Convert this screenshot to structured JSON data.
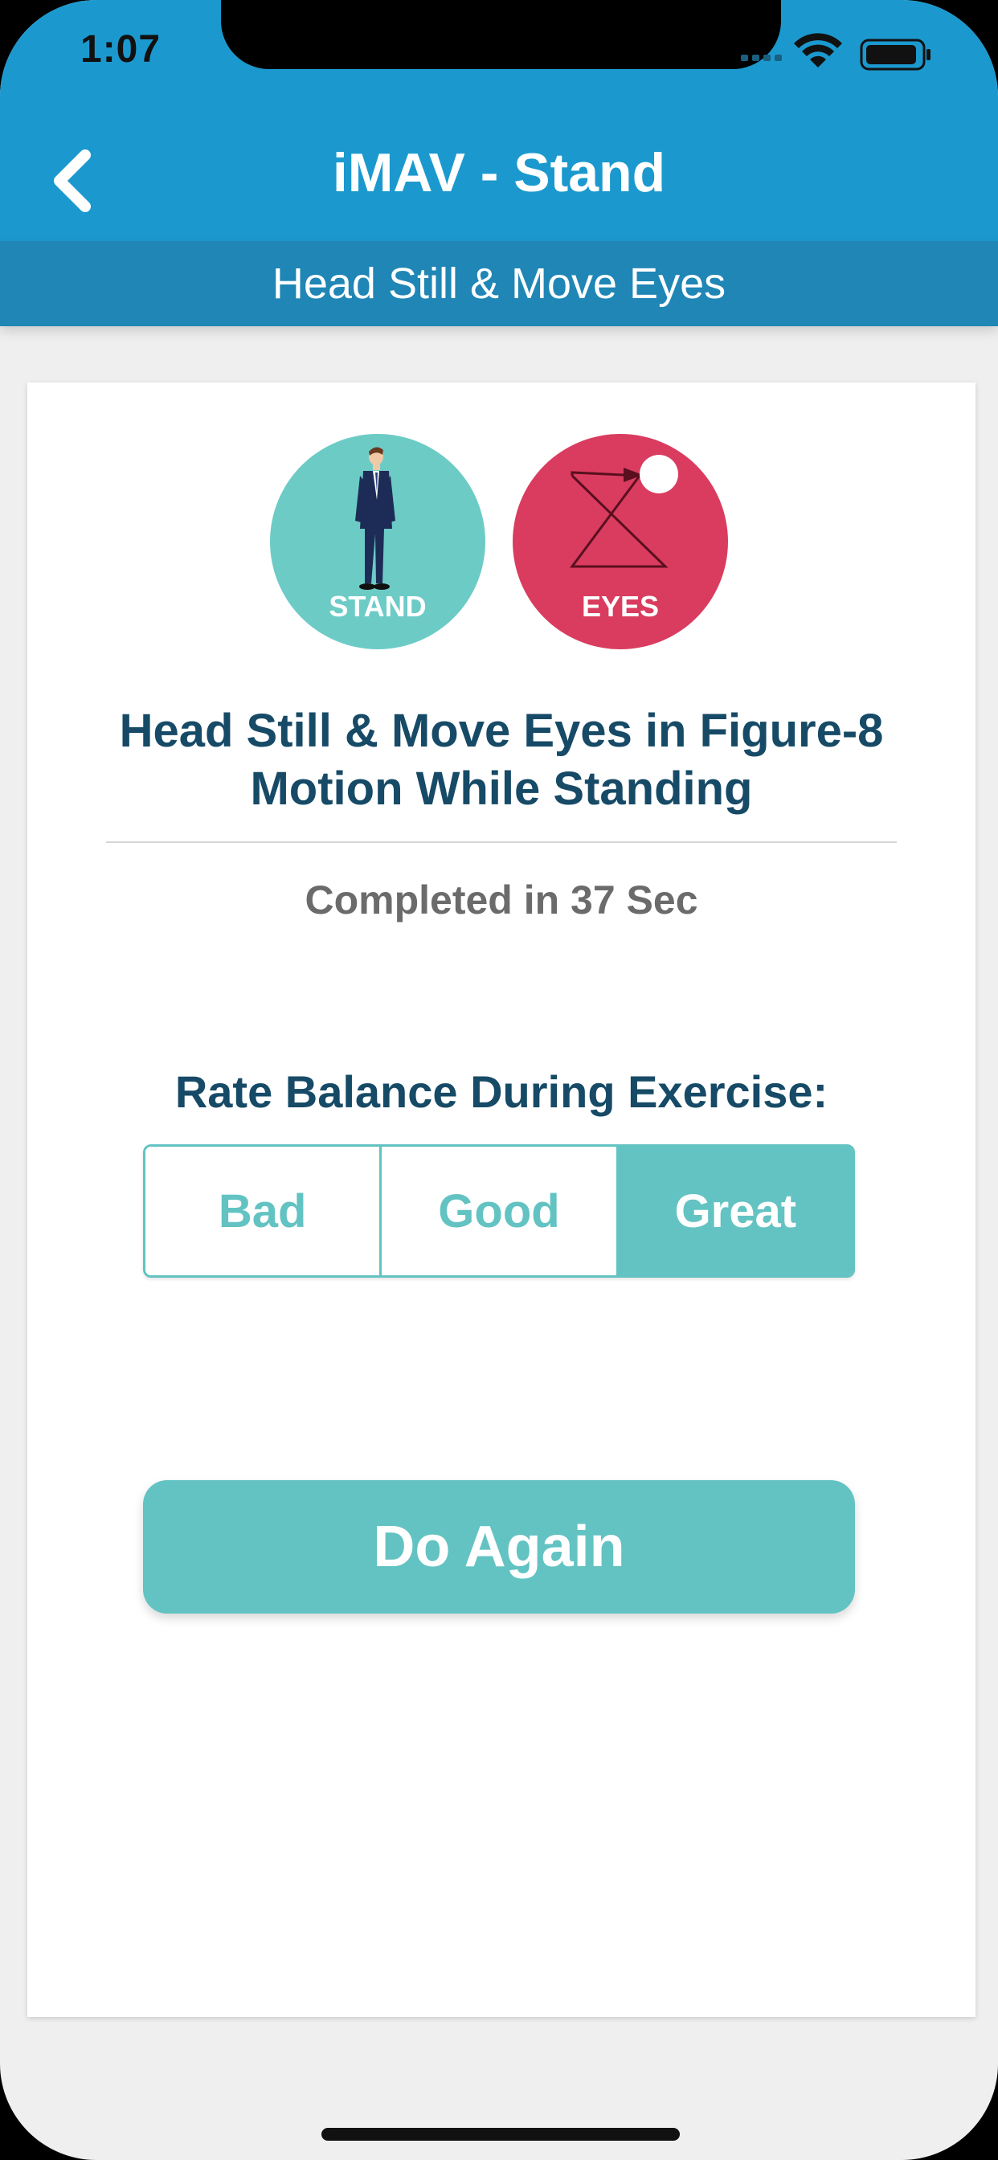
{
  "status_bar": {
    "time": "1:07"
  },
  "nav": {
    "title": "iMAV - Stand",
    "back_icon": "chevron-left-icon"
  },
  "subheader": {
    "title": "Head Still & Move Eyes"
  },
  "badges": [
    {
      "label": "STAND",
      "icon": "standing-person-icon",
      "color": "#6dcbc6"
    },
    {
      "label": "EYES",
      "icon": "figure-8-eye-motion-icon",
      "color": "#d93c5f"
    }
  ],
  "exercise": {
    "title_line1": "Head Still & Move Eyes in Figure-8",
    "title_line2": "Motion While Standing",
    "completed": "Completed in 37 Sec"
  },
  "rating": {
    "label": "Rate Balance During Exercise:",
    "options": [
      "Bad",
      "Good",
      "Great"
    ],
    "selected": "Great"
  },
  "actions": {
    "do_again": "Do Again"
  },
  "colors": {
    "header_blue": "#1b99ce",
    "subheader_blue": "#1f86b6",
    "teal": "#62c3c2",
    "title_navy": "#164a66"
  }
}
